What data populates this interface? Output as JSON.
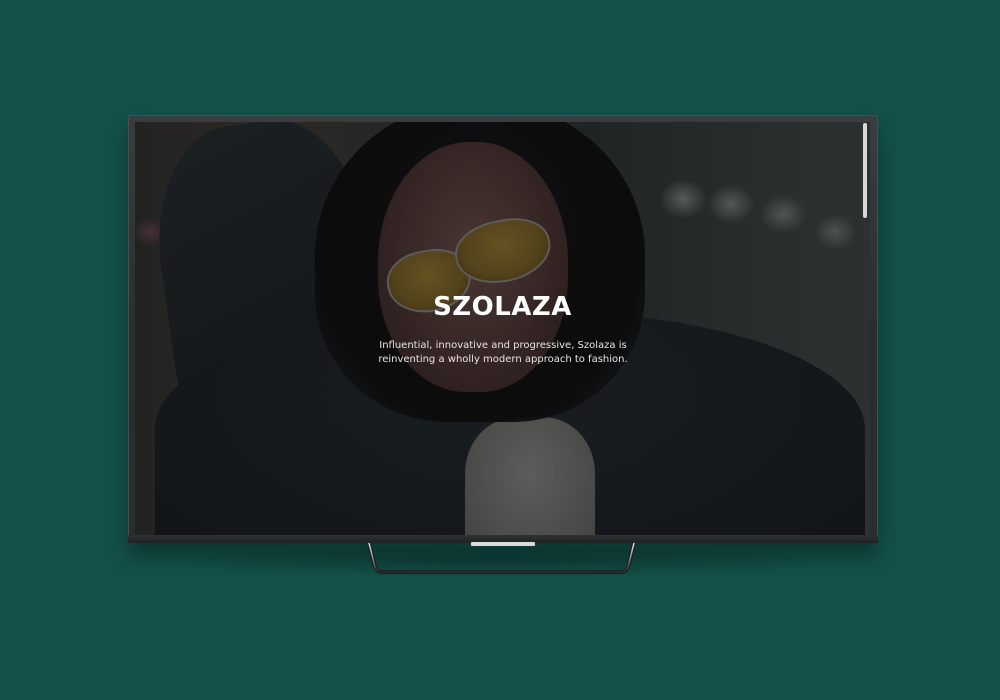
{
  "page": {
    "background_color": "#13514a",
    "device": "tv-mockup"
  },
  "screen": {
    "hero": {
      "title": "SZOLAZA",
      "tagline": "Influential, innovative and progressive, Szolaza is reinventing a wholly modern approach to fashion.",
      "image_alt": "Woman with dark hair, yellow aviator sunglasses and denim jacket"
    },
    "scrollbar": {
      "position_fraction": 0.0
    }
  }
}
